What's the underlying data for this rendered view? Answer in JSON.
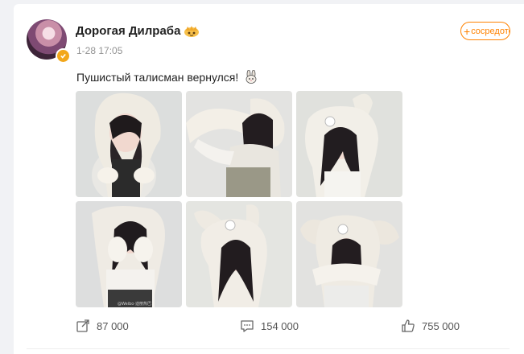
{
  "post": {
    "username": "Дорогая Дилраба",
    "timestamp": "1-28 17:05",
    "follow_label": "сосредоточиться",
    "text": "Пушистый талисман вернулся!",
    "images": [
      "photo-1",
      "photo-2",
      "photo-3",
      "photo-4",
      "photo-5",
      "photo-6"
    ],
    "watermark": "@Weibo·迪丽热巴"
  },
  "actions": {
    "reposts": "87 000",
    "comments": "154 000",
    "likes": "755 000"
  },
  "icons": {
    "verified": "verified-badge-icon",
    "crown": "crown-icon",
    "emoji": "rabbit-emoji-icon",
    "repost": "repost-icon",
    "comment": "comment-icon",
    "like": "like-icon"
  },
  "colors": {
    "accent": "#ff8200",
    "verified": "#f2a71b",
    "background": "#f1f2f5"
  }
}
